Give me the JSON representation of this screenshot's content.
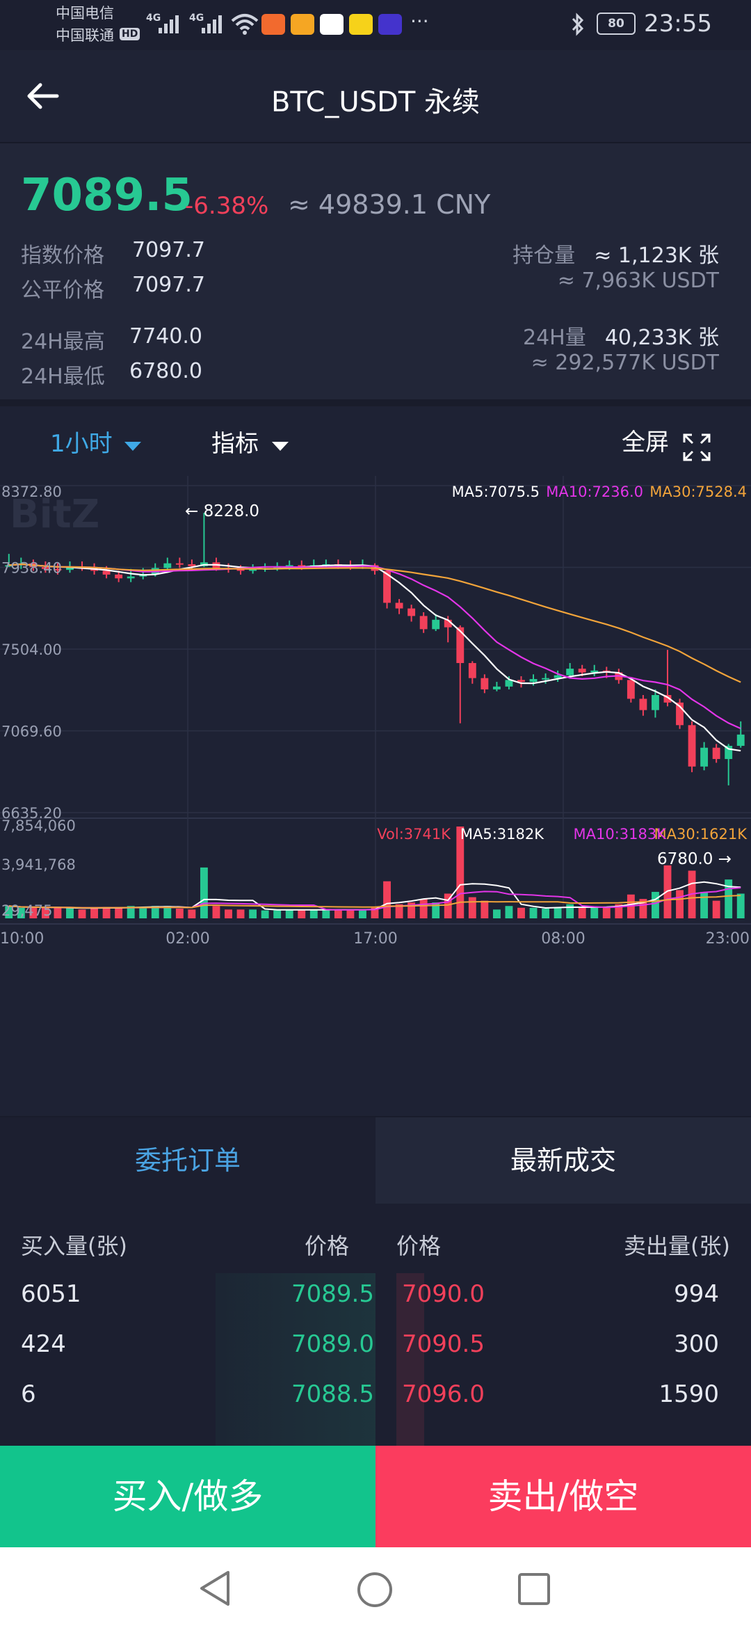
{
  "status_bar": {
    "carrier1": "中国电信",
    "carrier2": "中国联通",
    "hd": "HD",
    "net1": "4G",
    "net2": "4G",
    "apps": [
      {
        "name": "app-icon-1",
        "color": "#f26a2e"
      },
      {
        "name": "app-icon-2",
        "color": "#f5a623"
      },
      {
        "name": "app-icon-3",
        "color": "#ffffff"
      },
      {
        "name": "app-icon-4",
        "color": "#f6d21a"
      },
      {
        "name": "app-icon-5",
        "color": "#4433cc"
      }
    ],
    "more": "···",
    "battery": "80",
    "time": "23:55"
  },
  "header": {
    "back_icon": "arrow-left-icon",
    "title": "BTC_USDT 永续"
  },
  "ticker": {
    "price": "7089.5",
    "change_pct": "-6.38%",
    "cny": "≈ 49839.1 CNY",
    "index_label": "指数价格",
    "index_value": "7097.7",
    "fair_label": "公平价格",
    "fair_value": "7097.7",
    "high_label": "24H最高",
    "high_value": "7740.0",
    "low_label": "24H最低",
    "low_value": "6780.0",
    "oi_label": "持仓量",
    "oi_value": "≈ 1,123K 张",
    "oi_usdt": "≈ 7,963K USDT",
    "vol_label": "24H量",
    "vol_value": "40,233K 张",
    "vol_usdt": "≈ 292,577K USDT"
  },
  "toolbar": {
    "interval": "1小时",
    "indicator": "指标",
    "fullscreen": "全屏"
  },
  "chart_data": {
    "type": "candlestick",
    "watermark": "BitZ",
    "price_axis": [
      "8372.80",
      "7938.40",
      "7504.00",
      "7069.60",
      "6635.20"
    ],
    "ylim": [
      6635.2,
      8372.8
    ],
    "ma_legend": {
      "ma5": "MA5:7075.5",
      "ma10": "MA10:7236.0",
      "ma30": "MA30:7528.4"
    },
    "high_annotation": "← 8228.0",
    "low_annotation": "6780.0 →",
    "candles": [
      [
        7950,
        7950,
        8010,
        7940
      ],
      [
        7950,
        7960,
        7990,
        7930
      ],
      [
        7960,
        7940,
        7980,
        7920
      ],
      [
        7940,
        7930,
        7970,
        7910
      ],
      [
        7930,
        7925,
        7960,
        7900
      ],
      [
        7925,
        7940,
        7970,
        7910
      ],
      [
        7940,
        7935,
        7970,
        7920
      ],
      [
        7935,
        7920,
        7960,
        7900
      ],
      [
        7920,
        7900,
        7945,
        7880
      ],
      [
        7900,
        7880,
        7920,
        7860
      ],
      [
        7880,
        7890,
        7930,
        7860
      ],
      [
        7890,
        7900,
        7935,
        7875
      ],
      [
        7900,
        7935,
        7960,
        7890
      ],
      [
        7935,
        7960,
        7990,
        7920
      ],
      [
        7960,
        7955,
        7990,
        7935
      ],
      [
        7955,
        7945,
        7980,
        7930
      ],
      [
        7945,
        7965,
        8228,
        7940
      ],
      [
        7965,
        7935,
        7990,
        7920
      ],
      [
        7935,
        7930,
        7960,
        7910
      ],
      [
        7930,
        7920,
        7950,
        7900
      ],
      [
        7920,
        7930,
        7955,
        7905
      ],
      [
        7930,
        7935,
        7960,
        7915
      ],
      [
        7935,
        7940,
        7965,
        7920
      ],
      [
        7940,
        7950,
        7975,
        7925
      ],
      [
        7950,
        7945,
        7975,
        7925
      ],
      [
        7945,
        7950,
        7980,
        7930
      ],
      [
        7950,
        7955,
        7980,
        7935
      ],
      [
        7955,
        7950,
        7980,
        7930
      ],
      [
        7950,
        7945,
        7975,
        7925
      ],
      [
        7945,
        7950,
        7980,
        7930
      ],
      [
        7950,
        7920,
        7960,
        7900
      ],
      [
        7920,
        7750,
        7930,
        7720
      ],
      [
        7750,
        7720,
        7770,
        7690
      ],
      [
        7720,
        7680,
        7740,
        7650
      ],
      [
        7680,
        7610,
        7700,
        7590
      ],
      [
        7610,
        7660,
        7690,
        7600
      ],
      [
        7660,
        7620,
        7680,
        7540
      ],
      [
        7620,
        7430,
        7630,
        7110
      ],
      [
        7430,
        7350,
        7440,
        7320
      ],
      [
        7350,
        7290,
        7370,
        7270
      ],
      [
        7290,
        7305,
        7330,
        7280
      ],
      [
        7305,
        7340,
        7360,
        7290
      ],
      [
        7340,
        7330,
        7360,
        7300
      ],
      [
        7330,
        7345,
        7370,
        7310
      ],
      [
        7345,
        7350,
        7375,
        7320
      ],
      [
        7350,
        7365,
        7390,
        7330
      ],
      [
        7365,
        7400,
        7430,
        7350
      ],
      [
        7400,
        7380,
        7420,
        7360
      ],
      [
        7380,
        7390,
        7420,
        7360
      ],
      [
        7390,
        7380,
        7410,
        7350
      ],
      [
        7380,
        7340,
        7400,
        7320
      ],
      [
        7340,
        7240,
        7355,
        7220
      ],
      [
        7240,
        7180,
        7260,
        7150
      ],
      [
        7180,
        7260,
        7290,
        7140
      ],
      [
        7260,
        7220,
        7500,
        7200
      ],
      [
        7220,
        7100,
        7240,
        7080
      ],
      [
        7100,
        6880,
        7120,
        6850
      ],
      [
        6880,
        6980,
        7010,
        6860
      ],
      [
        6980,
        6920,
        7000,
        6900
      ],
      [
        6920,
        6990,
        7000,
        6780
      ],
      [
        6990,
        7050,
        7120,
        6980
      ]
    ],
    "volume_axis": [
      "7,854,060",
      "3,941,768",
      "29,475"
    ],
    "vol_legend": {
      "vol": "Vol:3741K",
      "ma5": "MA5:3182K",
      "ma10": "MA10:3183K",
      "ma30": "MA30:1621K"
    },
    "time_axis": [
      "10:00",
      "02:00",
      "17:00",
      "08:00",
      "23:00"
    ],
    "colors": {
      "up": "#27c993",
      "down": "#f2405a",
      "ma5": "#ffffff",
      "ma10": "#e335e8",
      "ma30": "#f2a43a"
    }
  },
  "tabs": {
    "orders": "委托订单",
    "trades": "最新成交"
  },
  "book": {
    "buy_qty_header": "买入量(张)",
    "buy_price_header": "价格",
    "sell_price_header": "价格",
    "sell_qty_header": "卖出量(张)",
    "rows": [
      {
        "bq": "6051",
        "bp": "7089.5",
        "sp": "7090.0",
        "sq": "994"
      },
      {
        "bq": "424",
        "bp": "7089.0",
        "sp": "7090.5",
        "sq": "300"
      },
      {
        "bq": "6",
        "bp": "7088.5",
        "sp": "7096.0",
        "sq": "1590"
      }
    ]
  },
  "actions": {
    "buy": "买入/做多",
    "sell": "卖出/做空"
  },
  "nav": {
    "back": "nav-back-icon",
    "home": "nav-home-icon",
    "recent": "nav-recent-icon"
  }
}
